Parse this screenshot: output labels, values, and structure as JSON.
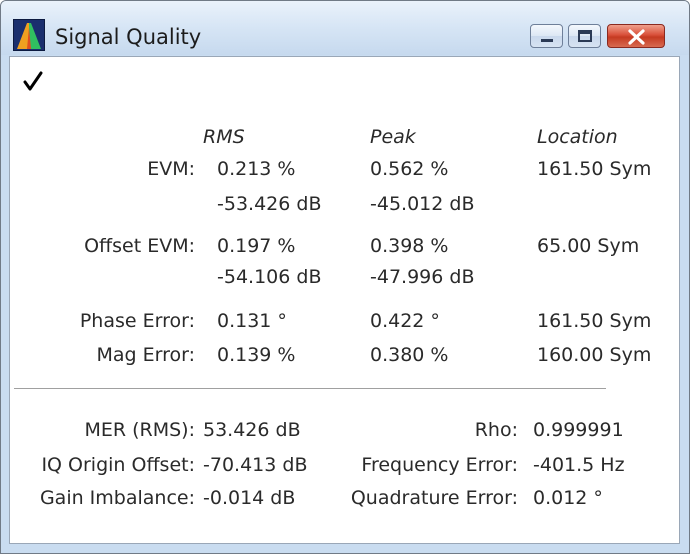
{
  "window": {
    "title": "Signal Quality",
    "icon": "tektronix-app-icon",
    "controls": {
      "minimize": "minimize-icon",
      "maximize": "maximize-icon",
      "close": "close-icon"
    }
  },
  "status": {
    "icon": "checkmark-icon",
    "color": "#000000"
  },
  "headers": {
    "rms": "RMS",
    "peak": "Peak",
    "location": "Location"
  },
  "rows": {
    "evm": {
      "label": "EVM:",
      "rms_pct": "0.213 %",
      "rms_db": "-53.426 dB",
      "peak_pct": "0.562 %",
      "peak_db": "-45.012 dB",
      "location": "161.50 Sym"
    },
    "offset_evm": {
      "label": "Offset EVM:",
      "rms_pct": "0.197 %",
      "rms_db": "-54.106 dB",
      "peak_pct": "0.398 %",
      "peak_db": "-47.996 dB",
      "location": "65.00 Sym"
    },
    "phase_error": {
      "label": "Phase Error:",
      "rms": "0.131 °",
      "peak": "0.422 °",
      "location": "161.50 Sym"
    },
    "mag_error": {
      "label": "Mag Error:",
      "rms": "0.139 %",
      "peak": "0.380 %",
      "location": "160.00 Sym"
    }
  },
  "summary": {
    "mer": {
      "label": "MER (RMS):",
      "value": "53.426 dB"
    },
    "iq_offset": {
      "label": "IQ Origin Offset:",
      "value": "-70.413 dB"
    },
    "gain_imbalance": {
      "label": "Gain Imbalance:",
      "value": "-0.014 dB"
    },
    "rho": {
      "label": "Rho:",
      "value": "0.999991"
    },
    "freq_error": {
      "label": "Frequency Error:",
      "value": "-401.5 Hz"
    },
    "quad_error": {
      "label": "Quadrature Error:",
      "value": "0.012 °"
    }
  },
  "colors": {
    "close_button": "#c53a21",
    "title_bar": "#d6e5f5",
    "client_bg": "#ffffff"
  }
}
